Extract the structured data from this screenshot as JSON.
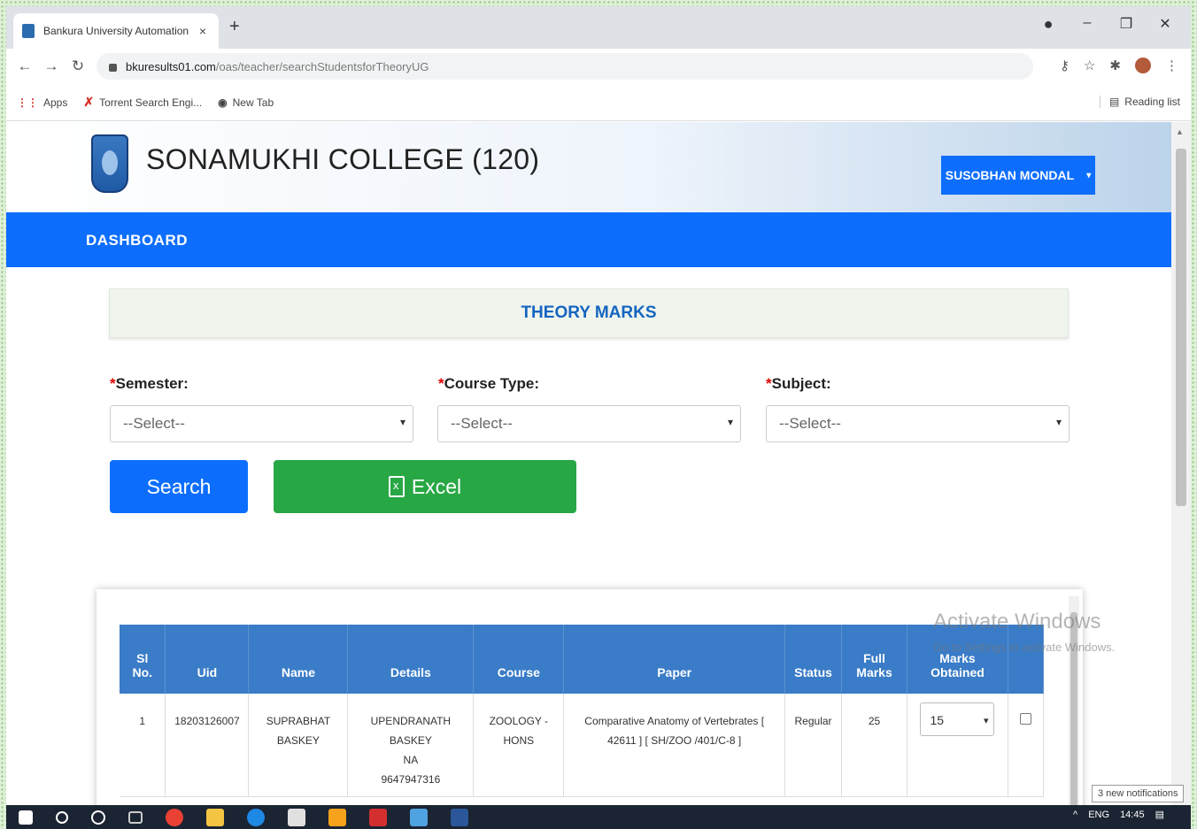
{
  "browser": {
    "tab_title": "Bankura University Automation",
    "tab_close": "×",
    "new_tab": "+",
    "url_host": "bkuresults01.com",
    "url_path": "/oas/teacher/searchStudentsforTheoryUG",
    "bookmarks": [
      {
        "label": "Apps"
      },
      {
        "label": "Torrent Search Engi..."
      },
      {
        "label": "New Tab"
      }
    ],
    "reading_list": "Reading list"
  },
  "header": {
    "college_name": "SONAMUKHI COLLEGE (120)",
    "user_name": "SUSOBHAN MONDAL",
    "user_caret": "▾"
  },
  "nav": {
    "dashboard": "DASHBOARD"
  },
  "page": {
    "section_title": "THEORY MARKS",
    "required_mark": "*",
    "semester_label": "Semester:",
    "course_type_label": "Course Type:",
    "subject_label": "Subject:",
    "semester_value": "--Select--",
    "course_type_value": "--Select--",
    "subject_value": "--Select--",
    "search_button": "Search",
    "excel_button": "Excel"
  },
  "table": {
    "headers": {
      "sl_no": "Sl No.",
      "uid": "Uid",
      "name": "Name",
      "details": "Details",
      "course": "Course",
      "paper": "Paper",
      "status": "Status",
      "full_marks": "Full Marks",
      "marks_obtained": "Marks Obtained",
      "select": ""
    },
    "rows": [
      {
        "sl_no": "1",
        "uid": "18203126007",
        "name": "SUPRABHAT BASKEY",
        "details_name": "UPENDRANATH BASKEY",
        "details_extra": "NA",
        "details_phone": "9647947316",
        "course": "ZOOLOGY - HONS",
        "paper": "Comparative Anatomy of Vertebrates [ 42611 ] [ SH/ZOO /401/C-8 ]",
        "status": "Regular",
        "full_marks": "25",
        "marks_obtained": "15"
      }
    ]
  },
  "overlay": {
    "watermark_title": "Activate Windows",
    "watermark_sub": "Go to Settings to activate Windows.",
    "notifications": "3 new notifications",
    "clock": "14:45",
    "lang": "ENG"
  },
  "colors": {
    "primary": "#0d6efd",
    "success": "#28a745",
    "table_header": "#3a7cc7",
    "theory_title": "#1565c0"
  }
}
